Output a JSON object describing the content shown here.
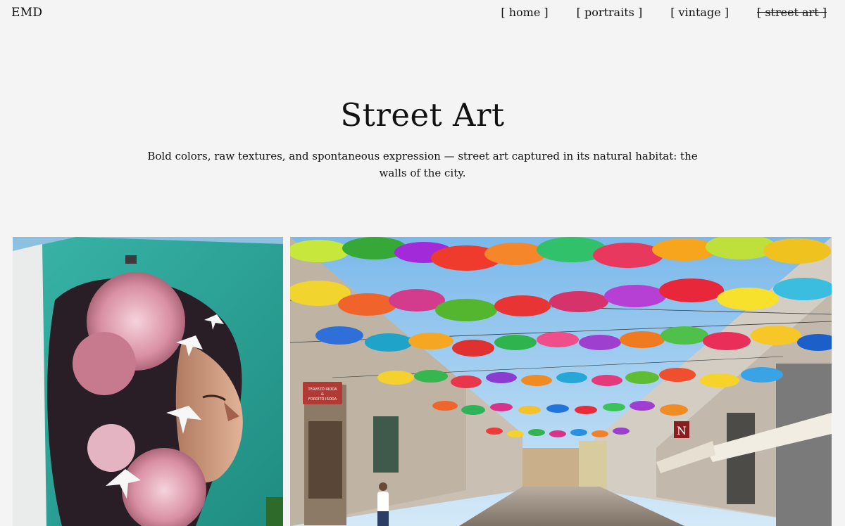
{
  "brand": "EMD",
  "nav": {
    "home": "[ home ]",
    "portraits": "[ portraits ]",
    "vintage": "[ vintage ]",
    "street_art": "[ street art ]"
  },
  "hero": {
    "title": "Street Art",
    "subtitle": "Bold colors, raw textures, and spontaneous expression — street art captured in its natural habitat: the walls of the city."
  },
  "gallery": {
    "items": [
      {
        "shop_sign": "TERVEZŐ IRODA\n&\nFORDÍTÓ IRODA",
        "store_letter": "N"
      }
    ]
  },
  "theme": {
    "background": "#f4f4f4",
    "text": "#111111",
    "mural_teal": "#2fa89b",
    "sky": "#8fc7ee"
  }
}
